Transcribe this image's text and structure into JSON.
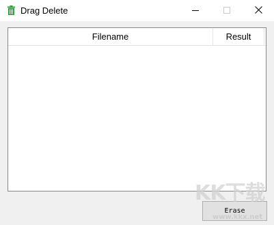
{
  "window": {
    "title": "Drag Delete",
    "icon": "trash-can-icon",
    "accent_color": "#2e9e3e",
    "controls": {
      "minimize": "minimize-icon",
      "maximize": "maximize-icon",
      "close": "close-icon"
    }
  },
  "file_list": {
    "columns": [
      "Filename",
      "Result"
    ],
    "rows": []
  },
  "actions": {
    "erase_label": "Erase"
  },
  "watermark": {
    "logo": "KK下载",
    "url": "www.kkx.net"
  }
}
